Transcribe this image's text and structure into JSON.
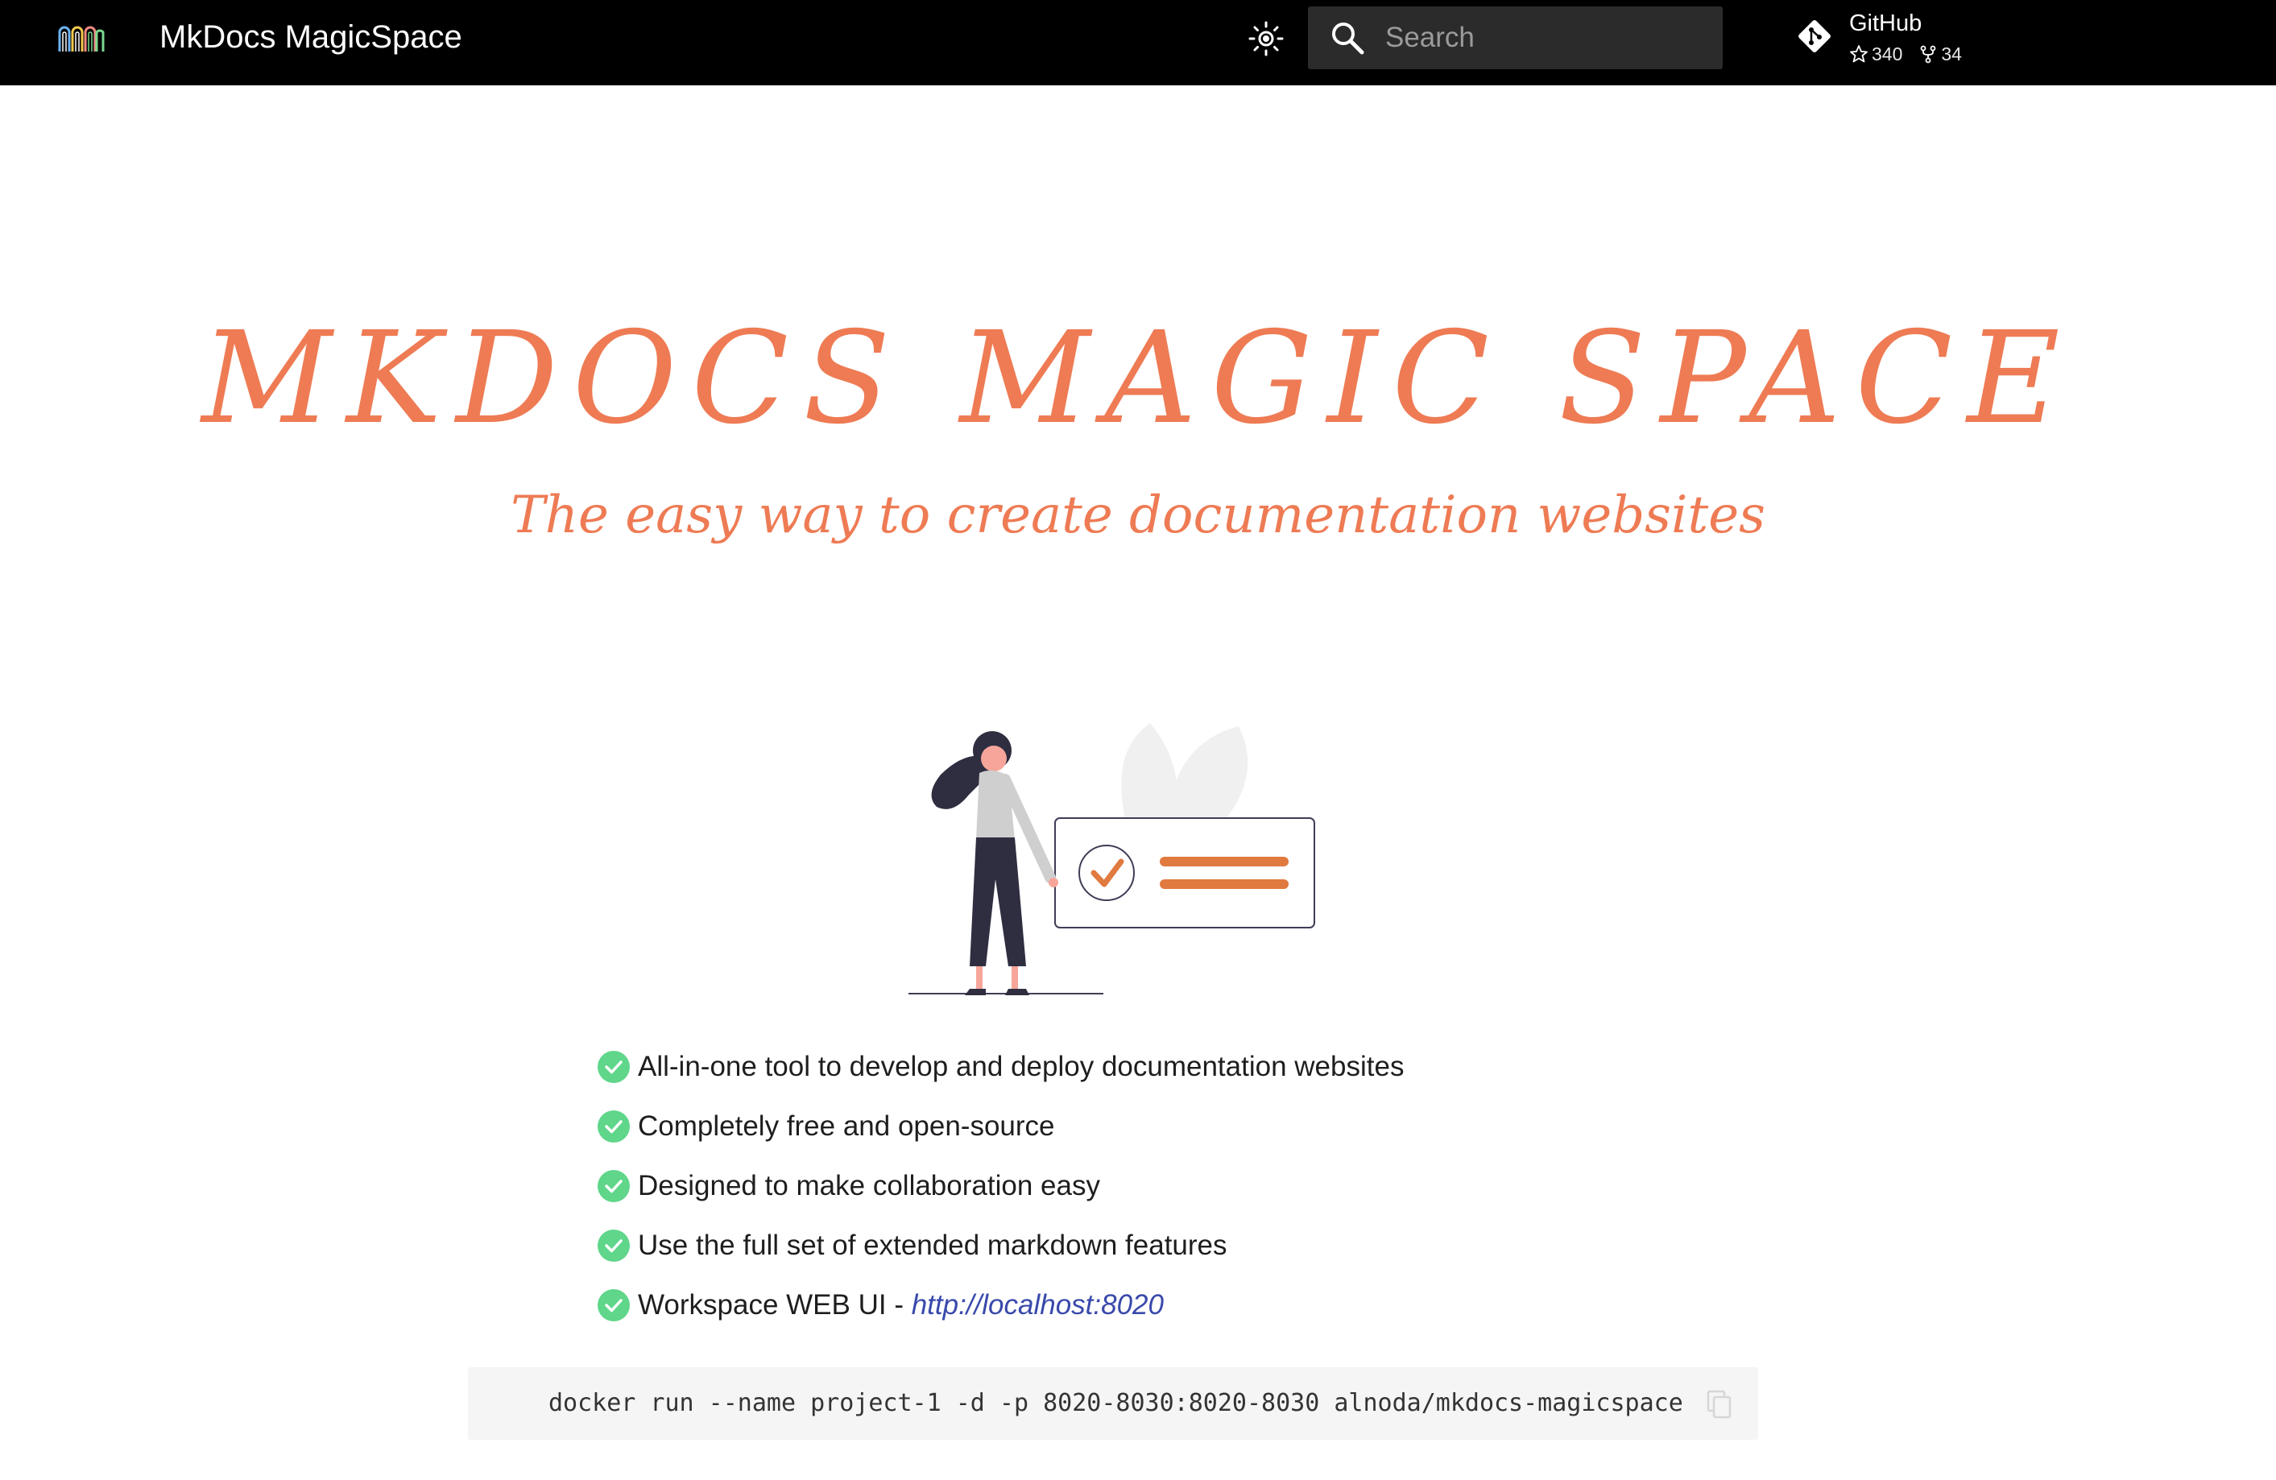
{
  "header": {
    "site_title": "MkDocs MagicSpace",
    "logo_icon": "logo-arches-icon",
    "theme_toggle_icon": "brightness-icon",
    "search": {
      "placeholder": "Search",
      "value": ""
    },
    "repo": {
      "name": "GitHub",
      "stars": "340",
      "forks": "34",
      "icon": "git-icon"
    }
  },
  "hero": {
    "title": "MKDOCS MAGIC SPACE",
    "subtitle": "The easy way to create documentation websites"
  },
  "features": [
    {
      "text": "All-in-one tool to develop and deploy documentation websites"
    },
    {
      "text": "Completely free and open-source"
    },
    {
      "text": "Designed to make collaboration easy"
    },
    {
      "text": "Use the full set of extended markdown features"
    },
    {
      "text": "Workspace WEB UI - ",
      "link": "http://localhost:8020"
    }
  ],
  "code": {
    "command": "docker run --name project-1 -d -p 8020-8030:8020-8030 alnoda/mkdocs-magicspace",
    "copy_icon": "copy-icon"
  },
  "colors": {
    "header_bg": "#000000",
    "accent": "#ee7b54",
    "check": "#5fd68a",
    "link": "#3949ab",
    "code_bg": "#f5f5f5"
  }
}
